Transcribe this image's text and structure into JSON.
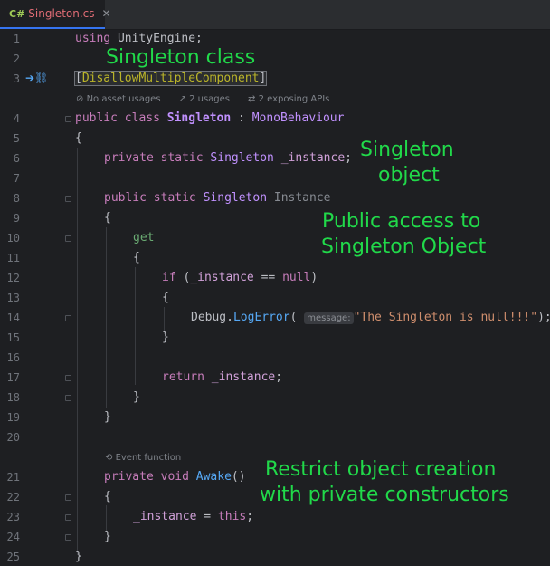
{
  "tab": {
    "lang_badge": "C#",
    "file_name": "Singleton.cs",
    "close_glyph": "✕"
  },
  "line_numbers": [
    "1",
    "2",
    "3",
    "4",
    "5",
    "6",
    "7",
    "8",
    "9",
    "10",
    "11",
    "12",
    "13",
    "14",
    "15",
    "16",
    "17",
    "18",
    "19",
    "20",
    "21",
    "22",
    "23",
    "24",
    "25"
  ],
  "code": {
    "l1_kw": "using",
    "l1_ns": "UnityEngine;",
    "l3_open": "[",
    "l3_attr": "DisallowMultipleComponent",
    "l3_close": "]",
    "l4_kw1": "public",
    "l4_kw2": "class",
    "l4_name": "Singleton",
    "l4_colon": ":",
    "l4_base": "MonoBehaviour",
    "l5": "{",
    "l6_kw1": "private",
    "l6_kw2": "static",
    "l6_type": "Singleton",
    "l6_field": "_instance",
    "l6_semi": ";",
    "l8_kw1": "public",
    "l8_kw2": "static",
    "l8_type": "Singleton",
    "l8_prop": "Instance",
    "l9": "{",
    "l10": "get",
    "l11": "{",
    "l12_kw": "if",
    "l12_open": "(",
    "l12_field": "_instance",
    "l12_op": "==",
    "l12_null": "null",
    "l12_close": ")",
    "l13": "{",
    "l14_cls": "Debug",
    "l14_dot": ".",
    "l14_fn": "LogError",
    "l14_paren": "(",
    "l14_hint": "message:",
    "l14_str": "\"The Singleton is null!!!\"",
    "l14_end": ");",
    "l15": "}",
    "l17_kw": "return",
    "l17_field": "_instance",
    "l17_semi": ";",
    "l18": "}",
    "l19": "}",
    "l21_kw1": "private",
    "l21_kw2": "void",
    "l21_fn": "Awake",
    "l21_paren": "()",
    "l22": "{",
    "l23_field": "_instance",
    "l23_eq": "=",
    "l23_this": "this",
    "l23_semi": ";",
    "l24": "}",
    "l25": "}"
  },
  "code_lens": {
    "asset_usages": "No asset usages",
    "usages": "2 usages",
    "exposing_apis": "2 exposing APIs",
    "event_function": "Event function"
  },
  "annotations": {
    "class_note": "Singleton class",
    "object_note_1": "Singleton",
    "object_note_2": "object",
    "access_note_1": "Public access to",
    "access_note_2": "Singleton Object",
    "restrict_note_1": "Restrict object creation",
    "restrict_note_2": "with private constructors"
  },
  "colors": {
    "annotation": "#21d94a",
    "keyword": "#c77dbb",
    "string": "#6aab73",
    "method": "#56a8f5",
    "background": "#1e1f22"
  }
}
